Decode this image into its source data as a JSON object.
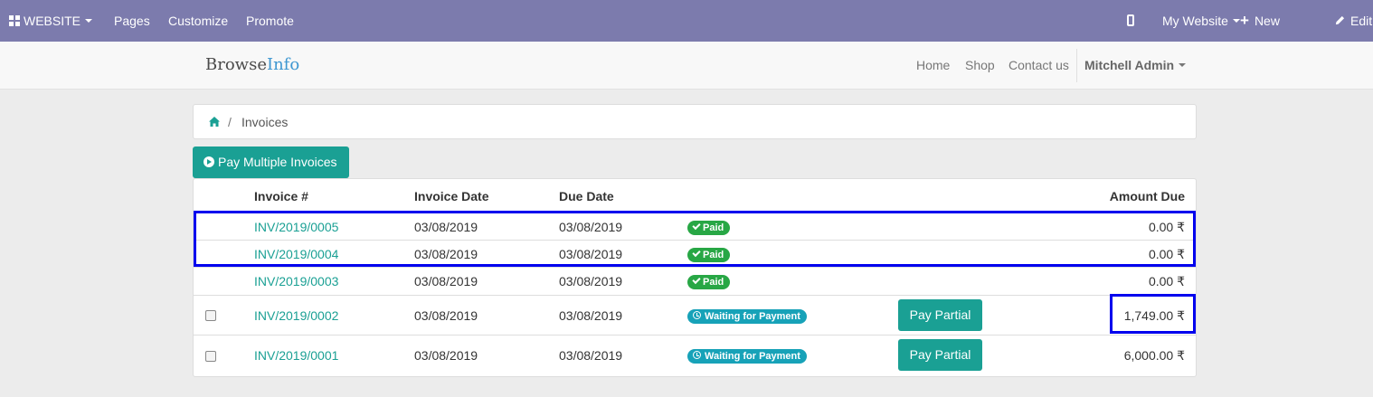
{
  "admin_bar": {
    "website_label": "WEBSITE",
    "pages": "Pages",
    "customize": "Customize",
    "promote": "Promote",
    "my_website": "My Website",
    "new": "New",
    "edit": "Edit"
  },
  "header": {
    "logo_part1": "Browse",
    "logo_part2": "Info",
    "nav_home": "Home",
    "nav_shop": "Shop",
    "nav_contact": "Contact us",
    "user": "Mitchell Admin"
  },
  "breadcrumb": {
    "separator": "/",
    "current": "Invoices"
  },
  "pay_multiple_label": "Pay Multiple Invoices",
  "table": {
    "headers": {
      "invoice": "Invoice #",
      "invoice_date": "Invoice Date",
      "due_date": "Due Date",
      "amount_due": "Amount Due"
    },
    "rows": [
      {
        "number": "INV/2019/0005",
        "invoice_date": "03/08/2019",
        "due_date": "03/08/2019",
        "status": "Paid",
        "amount": "0.00 ₹"
      },
      {
        "number": "INV/2019/0004",
        "invoice_date": "03/08/2019",
        "due_date": "03/08/2019",
        "status": "Paid",
        "amount": "0.00 ₹"
      },
      {
        "number": "INV/2019/0003",
        "invoice_date": "03/08/2019",
        "due_date": "03/08/2019",
        "status": "Paid",
        "amount": "0.00 ₹"
      },
      {
        "number": "INV/2019/0002",
        "invoice_date": "03/08/2019",
        "due_date": "03/08/2019",
        "status": "Waiting for Payment",
        "action": "Pay Partial",
        "amount": "1,749.00 ₹"
      },
      {
        "number": "INV/2019/0001",
        "invoice_date": "03/08/2019",
        "due_date": "03/08/2019",
        "status": "Waiting for Payment",
        "action": "Pay Partial",
        "amount": "6,000.00 ₹"
      }
    ]
  },
  "colors": {
    "admin_bar": "#7c7bad",
    "accent": "#1aa094",
    "paid_badge": "#28a745",
    "waiting_badge": "#17a2b8",
    "highlight": "#0000ee"
  },
  "icons": [
    "grid-icon",
    "caret-down-icon",
    "mobile-icon",
    "plus-icon",
    "pencil-icon",
    "home-icon",
    "arrow-circle-right-icon",
    "check-icon",
    "clock-icon"
  ]
}
